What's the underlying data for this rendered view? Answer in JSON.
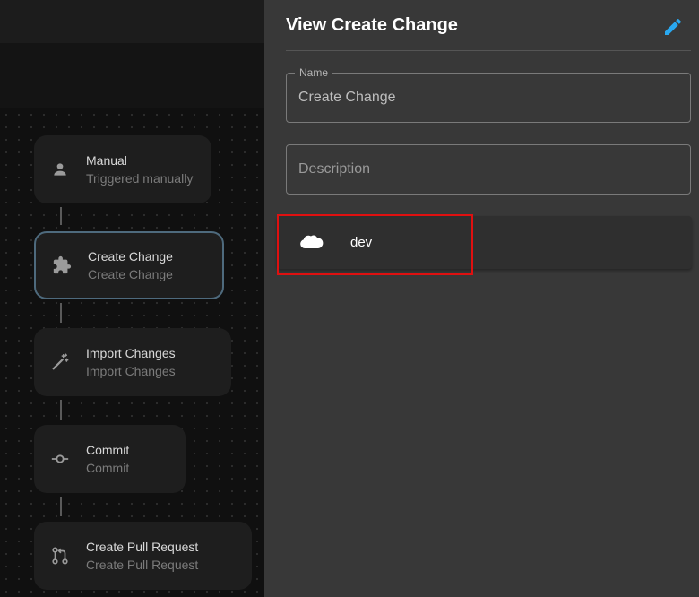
{
  "panel": {
    "title": "View Create Change",
    "name_field": {
      "label": "Name",
      "value": "Create Change"
    },
    "description_field": {
      "placeholder": "Description",
      "value": ""
    },
    "environment": {
      "name": "dev",
      "icon": "salesforce-cloud-icon"
    },
    "edit_icon": "pencil-icon"
  },
  "flow": {
    "nodes": [
      {
        "title": "Manual",
        "subtitle": "Triggered manually",
        "icon": "person-icon",
        "selected": false
      },
      {
        "title": "Create Change",
        "subtitle": "Create Change",
        "icon": "puzzle-icon",
        "selected": true
      },
      {
        "title": "Import Changes",
        "subtitle": "Import Changes",
        "icon": "magic-wand-icon",
        "selected": false
      },
      {
        "title": "Commit",
        "subtitle": "Commit",
        "icon": "commit-icon",
        "selected": false
      },
      {
        "title": "Create Pull Request",
        "subtitle": "Create Pull Request",
        "icon": "pull-request-icon",
        "selected": false
      }
    ]
  },
  "colors": {
    "accent": "#29a8f0",
    "highlight": "#e01010",
    "panel_bg": "#383838"
  }
}
